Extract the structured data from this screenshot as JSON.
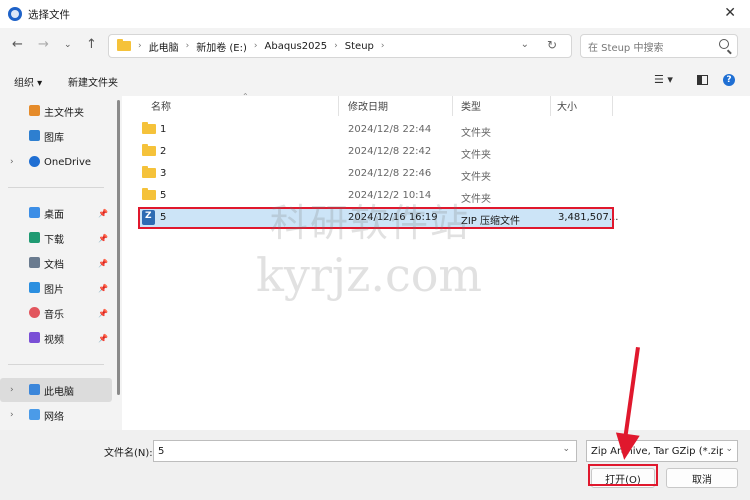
{
  "window": {
    "title": "选择文件"
  },
  "address": {
    "breadcrumbs": [
      "此电脑",
      "新加卷 (E:)",
      "Abaqus2025",
      "Steup"
    ],
    "search_placeholder": "在 Steup 中搜索"
  },
  "toolbar": {
    "organize": "组织 ▾",
    "new_folder": "新建文件夹"
  },
  "sidebar": {
    "quick": [
      {
        "label": "主文件夹",
        "icon": "home-icon",
        "color": "#e58b2a"
      },
      {
        "label": "图库",
        "icon": "gallery-icon",
        "color": "#2e7fd0"
      },
      {
        "label": "OneDrive",
        "icon": "cloud-icon",
        "color": "#1f6fd3"
      }
    ],
    "pinned": [
      {
        "label": "桌面",
        "icon": "desktop-icon",
        "color": "#3c8ee6"
      },
      {
        "label": "下载",
        "icon": "download-icon",
        "color": "#1f9a72"
      },
      {
        "label": "文档",
        "icon": "document-icon",
        "color": "#6a7b8f"
      },
      {
        "label": "图片",
        "icon": "pictures-icon",
        "color": "#2b8fe0"
      },
      {
        "label": "音乐",
        "icon": "music-icon",
        "color": "#e2565e"
      },
      {
        "label": "视频",
        "icon": "video-icon",
        "color": "#7a4fd6"
      }
    ],
    "devices": [
      {
        "label": "此电脑",
        "icon": "computer-icon",
        "color": "#3b86da"
      },
      {
        "label": "网络",
        "icon": "network-icon",
        "color": "#4b9be8"
      }
    ]
  },
  "columns": {
    "name": "名称",
    "modified": "修改日期",
    "type": "类型",
    "size": "大小"
  },
  "files": [
    {
      "name": "1",
      "modified": "2024/12/8 22:44",
      "type": "文件夹",
      "size": ""
    },
    {
      "name": "2",
      "modified": "2024/12/8 22:42",
      "type": "文件夹",
      "size": ""
    },
    {
      "name": "3",
      "modified": "2024/12/8 22:46",
      "type": "文件夹",
      "size": ""
    },
    {
      "name": "5",
      "modified": "2024/12/2 10:14",
      "type": "文件夹",
      "size": ""
    },
    {
      "name": "5",
      "modified": "2024/12/16 16:19",
      "type": "ZIP 压缩文件",
      "size": "3,481,507..."
    }
  ],
  "bottom": {
    "filename_label": "文件名(N):",
    "filename_value": "5",
    "filetype_value": "Zip Archive, Tar GZip (*.zip *",
    "open_label": "打开(O)",
    "cancel_label": "取消"
  },
  "watermark": {
    "cn": "科研软件站",
    "en": "kyrjz.com"
  },
  "colors": {
    "highlight": "#e0182d",
    "selection": "#cce4f7",
    "folder": "#f5c23a"
  }
}
